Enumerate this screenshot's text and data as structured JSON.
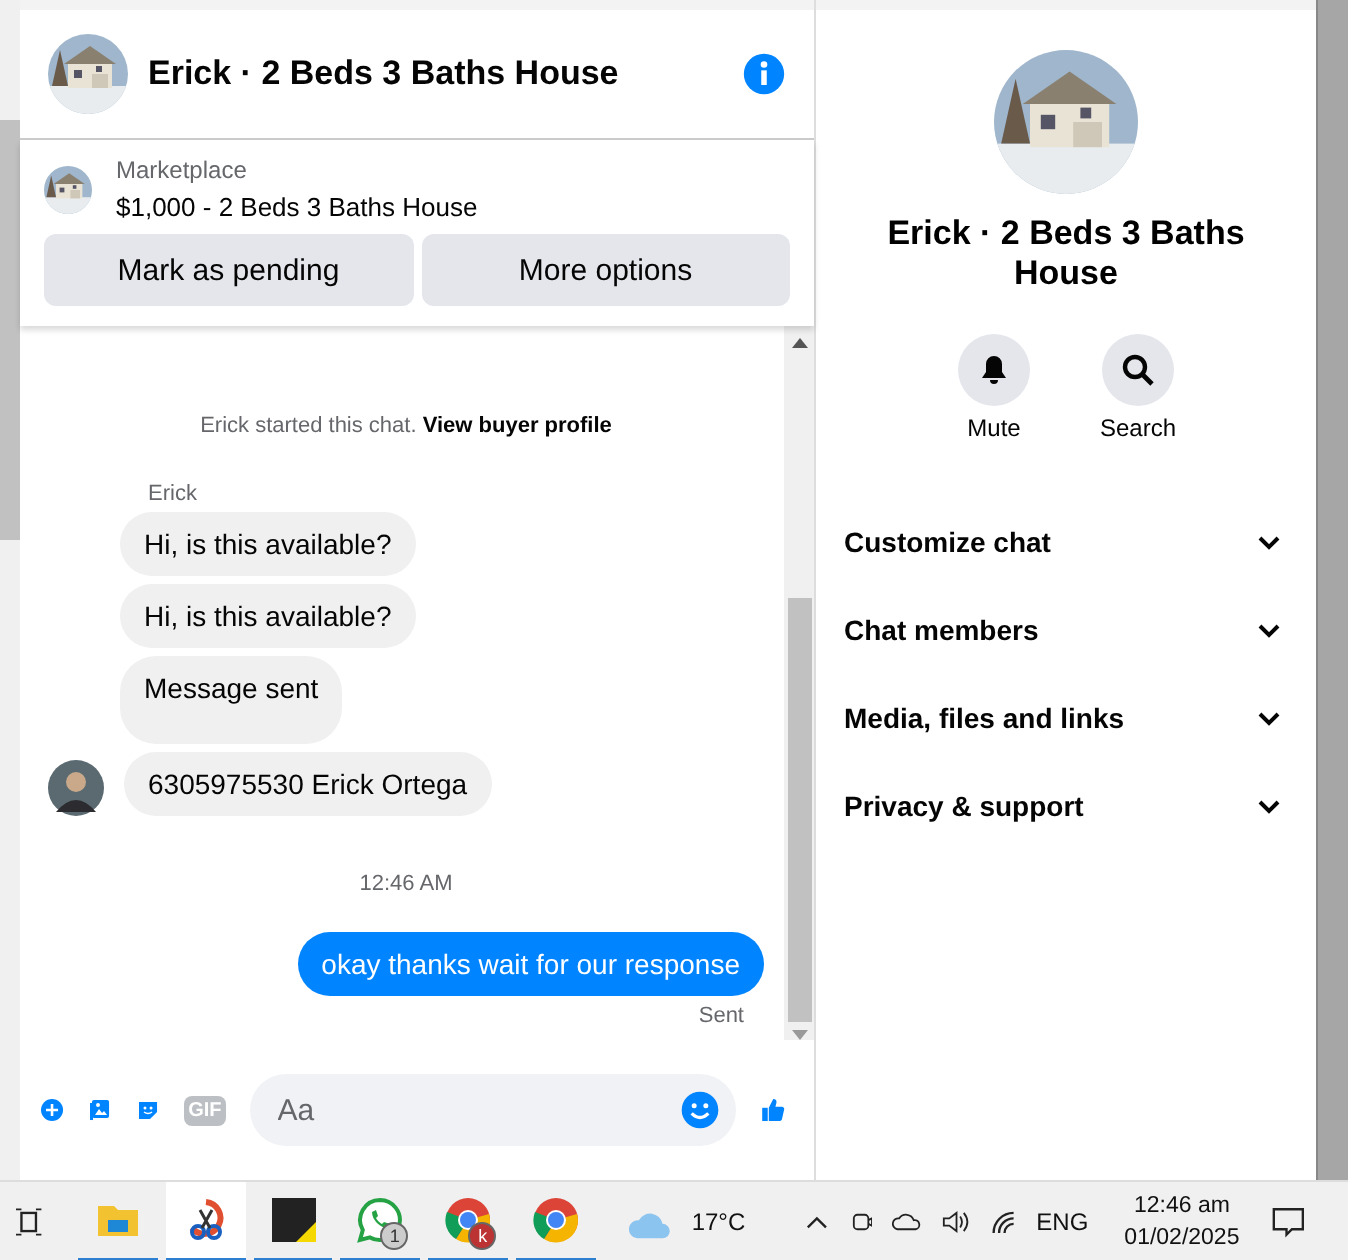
{
  "header": {
    "title": "Erick · 2 Beds 3 Baths House"
  },
  "listing": {
    "source": "Marketplace",
    "title": "$1,000 - 2 Beds 3 Baths House",
    "buttons": [
      "Mark as pending",
      "More options"
    ]
  },
  "intro": {
    "text": "Erick started this chat.",
    "link": "View buyer profile"
  },
  "messages": [
    {
      "kind": "sender",
      "text": "Erick"
    },
    {
      "kind": "incoming",
      "text": "Hi, is this available?"
    },
    {
      "kind": "incoming",
      "text": "Hi, is this available?"
    },
    {
      "kind": "incoming",
      "text": "Message sent"
    },
    {
      "kind": "incoming",
      "text": "6305975530 Erick Ortega",
      "avatar": true
    },
    {
      "kind": "time",
      "text": "12:46 AM"
    },
    {
      "kind": "outgoing",
      "text": "okay thanks wait for our response"
    },
    {
      "kind": "status",
      "text": "Sent"
    }
  ],
  "composer": {
    "placeholder": "Aa",
    "gif_label": "GIF"
  },
  "details": {
    "title": "Erick · 2 Beds 3 Baths House",
    "actions": [
      {
        "kind": "mute",
        "label": "Mute"
      },
      {
        "kind": "search",
        "label": "Search"
      }
    ],
    "sections": [
      "Customize chat",
      "Chat members",
      "Media, files and links",
      "Privacy & support"
    ]
  },
  "taskbar": {
    "apps": [
      {
        "kind": "folder"
      },
      {
        "kind": "scissors"
      },
      {
        "kind": "notes"
      },
      {
        "kind": "chat",
        "badge": "1"
      },
      {
        "kind": "browser",
        "badge": "k"
      },
      {
        "kind": "browser"
      }
    ],
    "weather": "17°C",
    "language": "ENG",
    "time": "12:46 am",
    "date": "01/02/2025"
  }
}
